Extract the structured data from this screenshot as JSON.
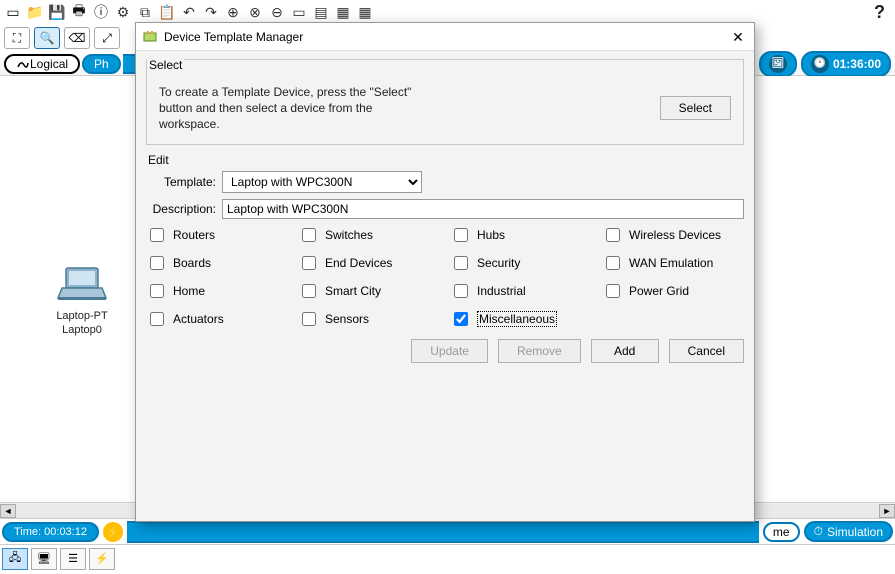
{
  "dialog": {
    "title": "Device Template Manager",
    "select": {
      "legend": "Select",
      "text": "To create a Template Device, press the \"Select\" button and then select a device from the workspace.",
      "button": "Select"
    },
    "edit": {
      "legend": "Edit",
      "template_label": "Template:",
      "template_value": "Laptop with WPC300N",
      "description_label": "Description:",
      "description_value": "Laptop with WPC300N",
      "checks": [
        {
          "label": "Routers",
          "checked": false
        },
        {
          "label": "Switches",
          "checked": false
        },
        {
          "label": "Hubs",
          "checked": false
        },
        {
          "label": "Wireless Devices",
          "checked": false
        },
        {
          "label": "Boards",
          "checked": false
        },
        {
          "label": "End Devices",
          "checked": false
        },
        {
          "label": "Security",
          "checked": false
        },
        {
          "label": "WAN Emulation",
          "checked": false
        },
        {
          "label": "Home",
          "checked": false
        },
        {
          "label": "Smart City",
          "checked": false
        },
        {
          "label": "Industrial",
          "checked": false
        },
        {
          "label": "Power Grid",
          "checked": false
        },
        {
          "label": "Actuators",
          "checked": false
        },
        {
          "label": "Sensors",
          "checked": false
        },
        {
          "label": "Miscellaneous",
          "checked": true,
          "focused": true
        }
      ],
      "buttons": {
        "update": "Update",
        "remove": "Remove",
        "add": "Add",
        "cancel": "Cancel"
      }
    }
  },
  "tabs": {
    "logical": "Logical",
    "physical_fragment": "Ph"
  },
  "clock_time": "01:36:00",
  "workspace": {
    "device": {
      "line1": "Laptop-PT",
      "line2": "Laptop0"
    }
  },
  "bottom": {
    "time": "Time: 00:03:12",
    "realtime_fragment": "me",
    "simulation": "Simulation"
  }
}
